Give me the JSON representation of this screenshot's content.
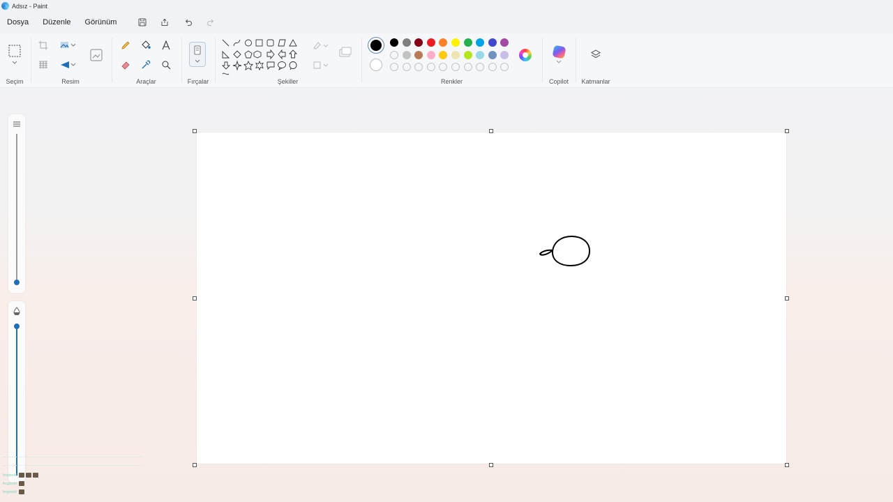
{
  "window": {
    "title": "Adsız - Paint"
  },
  "menu": {
    "items": [
      "Dosya",
      "Düzenle",
      "Görünüm"
    ]
  },
  "ribbon": {
    "groups": {
      "selection": "Seçim",
      "image": "Resim",
      "tools": "Araçlar",
      "brushes": "Fırçalar",
      "shapes": "Şekiller",
      "colors": "Renkler",
      "copilot": "Copilot",
      "layers": "Katmanlar"
    }
  },
  "colors": {
    "primary": "#000000",
    "secondary": "#ffffff",
    "palette_row1": [
      "#000000",
      "#7f7f7f",
      "#880015",
      "#ed1c24",
      "#ff7f27",
      "#fff200",
      "#22b14c",
      "#00a2e8",
      "#3f48cc",
      "#a349a4"
    ],
    "palette_row2": [
      "empty",
      "#c3c3c3",
      "#b97a57",
      "#ffaec9",
      "#ffc90e",
      "#efe4b0",
      "#b5e61d",
      "#99d9ea",
      "#7092be",
      "#c8bfe7"
    ],
    "palette_row3": [
      "empty",
      "empty",
      "empty",
      "empty",
      "empty",
      "empty",
      "empty",
      "empty",
      "empty",
      "empty"
    ],
    "accent": "#1e6fb8"
  },
  "chat": {
    "lines": [
      {
        "user": "froglordd",
        "badges": 3
      },
      {
        "user": "froglordd",
        "badges": 1
      },
      {
        "user": "froglordd",
        "badges": 1
      }
    ]
  }
}
